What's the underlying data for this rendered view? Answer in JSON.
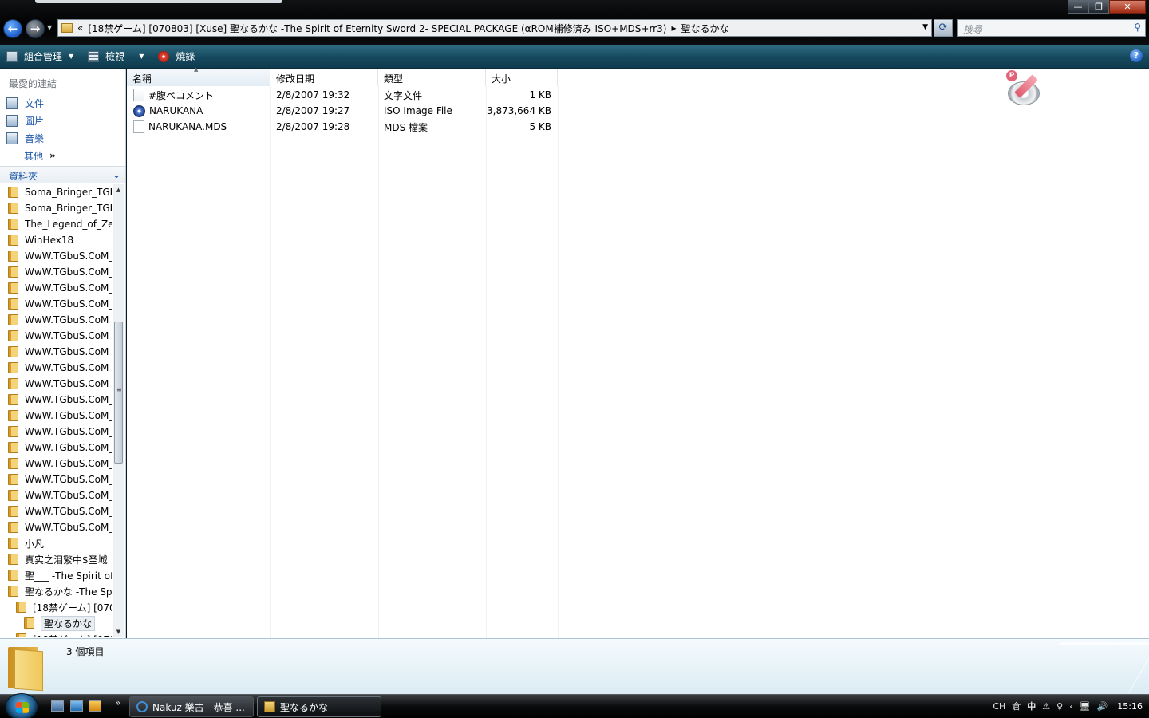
{
  "window": {
    "address_prefix": "«",
    "address_path": "[18禁ゲーム] [070803] [Xuse] 聖なるかな -The Spirit of Eternity Sword 2- SPECIAL PACKAGE (αROM補修済み ISO+MDS+rr3)",
    "address_sep": "▸",
    "address_current": "聖なるかな",
    "search_placeholder": "搜尋",
    "minimize": "—",
    "maximize": "❐",
    "close": "✕"
  },
  "toolbar": {
    "organize": "組合管理",
    "views": "檢視",
    "burn": "燒錄",
    "help": "?"
  },
  "nav": {
    "favorites_header": "最愛的連結",
    "favorites": [
      "文件",
      "圖片",
      "音樂"
    ],
    "more": "其他",
    "more_chevron": "»",
    "folders_header": "資料夾",
    "folders": [
      {
        "label": "Soma_Bringer_TGB",
        "indent": 0
      },
      {
        "label": "Soma_Bringer_TGB",
        "indent": 0
      },
      {
        "label": "The_Legend_of_Zel",
        "indent": 0
      },
      {
        "label": "WinHex18",
        "indent": 0
      },
      {
        "label": "WwW.TGbuS.CoM_",
        "indent": 0
      },
      {
        "label": "WwW.TGbuS.CoM_",
        "indent": 0
      },
      {
        "label": "WwW.TGbuS.CoM_",
        "indent": 0
      },
      {
        "label": "WwW.TGbuS.CoM_",
        "indent": 0
      },
      {
        "label": "WwW.TGbuS.CoM_",
        "indent": 0
      },
      {
        "label": "WwW.TGbuS.CoM_",
        "indent": 0
      },
      {
        "label": "WwW.TGbuS.CoM_",
        "indent": 0
      },
      {
        "label": "WwW.TGbuS.CoM_",
        "indent": 0
      },
      {
        "label": "WwW.TGbuS.CoM_",
        "indent": 0
      },
      {
        "label": "WwW.TGbuS.CoM_",
        "indent": 0
      },
      {
        "label": "WwW.TGbuS.CoM_",
        "indent": 0
      },
      {
        "label": "WwW.TGbuS.CoM_",
        "indent": 0
      },
      {
        "label": "WwW.TGbuS.CoM_",
        "indent": 0
      },
      {
        "label": "WwW.TGbuS.CoM_",
        "indent": 0
      },
      {
        "label": "WwW.TGbuS.CoM_",
        "indent": 0
      },
      {
        "label": "WwW.TGbuS.CoM_",
        "indent": 0
      },
      {
        "label": "WwW.TGbuS.CoM_",
        "indent": 0
      },
      {
        "label": "WwW.TGbuS.CoM_",
        "indent": 0
      },
      {
        "label": "小凡",
        "indent": 0
      },
      {
        "label": "真实之泪繁中$圣城",
        "indent": 0
      },
      {
        "label": "聖___ -The Spirit of",
        "indent": 0
      },
      {
        "label": "聖なるかな -The Sp",
        "indent": 0
      },
      {
        "label": "[18禁ゲーム] [070",
        "indent": 1
      },
      {
        "label": "聖なるかな",
        "indent": 2,
        "selected": true
      },
      {
        "label": "[18禁ゲーム] [070",
        "indent": 1
      }
    ]
  },
  "list": {
    "columns": [
      "名稱",
      "修改日期",
      "類型",
      "大小"
    ],
    "files": [
      {
        "icon": "text-file-icon",
        "name": "#腹ペコメント",
        "date": "2/8/2007 19:32",
        "type": "文字文件",
        "size": "1 KB"
      },
      {
        "icon": "iso-disc-icon",
        "name": "NARUKANA",
        "date": "2/8/2007 19:27",
        "type": "ISO Image File",
        "size": "3,873,664 KB"
      },
      {
        "icon": "mds-file-icon",
        "name": "NARUKANA.MDS",
        "date": "2/8/2007 19:28",
        "type": "MDS 檔案",
        "size": "5 KB"
      }
    ]
  },
  "details": {
    "item_count": "3 個項目"
  },
  "taskbar": {
    "quicklaunch_more": "»",
    "tasks": [
      "Nakuz 樂古 - 恭喜 ...",
      "聖なるかな"
    ],
    "tray": [
      "CH",
      "倉",
      "中",
      "⚠",
      "♀",
      "‹",
      "🖥",
      "🔊"
    ],
    "clock": "15:16"
  },
  "colors": {
    "toolbar": "#16495e",
    "link": "#1c56a8",
    "details_bg": "#dcecf4",
    "taskbar": "#0a0b0c"
  }
}
